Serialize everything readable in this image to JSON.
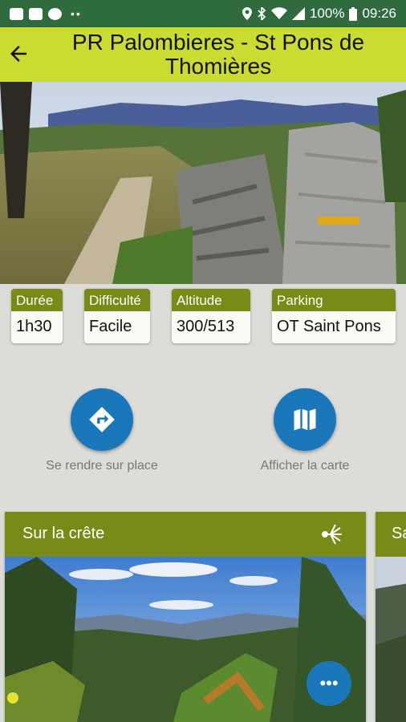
{
  "status_bar": {
    "battery": "100%",
    "time": "09:26"
  },
  "app_bar": {
    "title": "PR Palombieres - St Pons de Thomières"
  },
  "info_chips": [
    {
      "label": "Durée",
      "value": "1h30"
    },
    {
      "label": "Difficulté",
      "value": "Facile"
    },
    {
      "label": "Altitude",
      "value": "300/513"
    },
    {
      "label": "Parking",
      "value": "OT Saint Pons"
    }
  ],
  "actions": [
    {
      "label": "Se rendre sur place",
      "icon": "directions-icon"
    },
    {
      "label": "Afficher la carte",
      "icon": "map-icon"
    }
  ],
  "cards": [
    {
      "title": "Sur la crête",
      "icon": "sparkle-icon"
    },
    {
      "title": "Sa"
    }
  ],
  "colors": {
    "status_bar": "#2f6b3c",
    "app_bar": "#c9dc2f",
    "olive": "#7a8a17",
    "fab_blue": "#1a78ba",
    "background": "#dcdcd9"
  }
}
